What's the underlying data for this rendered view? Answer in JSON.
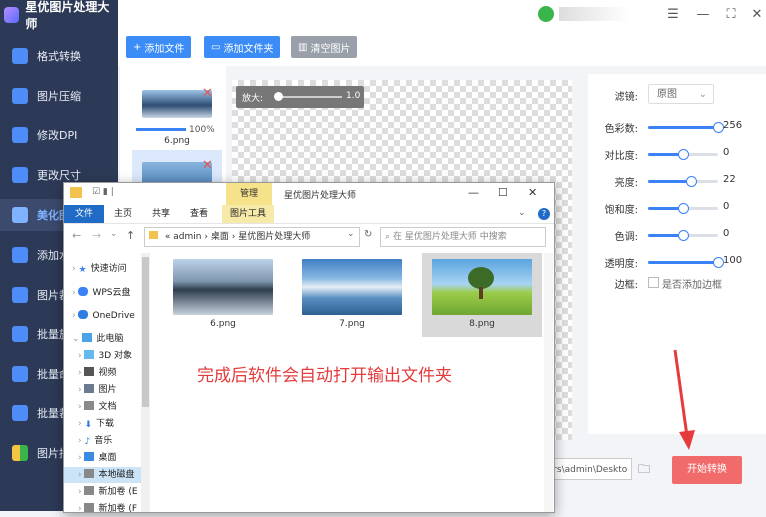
{
  "app": {
    "title": "星优图片处理大师"
  },
  "topbar": {
    "icons": [
      "user-avatar",
      "settings-icon",
      "minimize-icon",
      "maximize-icon",
      "close-icon"
    ]
  },
  "sidebar": {
    "items": [
      {
        "label": "格式转换",
        "icon": "format-convert-icon"
      },
      {
        "label": "图片压缩",
        "icon": "compress-icon"
      },
      {
        "label": "修改DPI",
        "icon": "dpi-icon"
      },
      {
        "label": "更改尺寸",
        "icon": "resize-icon"
      },
      {
        "label": "美化图片",
        "icon": "beautify-icon",
        "active": true
      },
      {
        "label": "添加水印",
        "icon": "watermark-icon"
      },
      {
        "label": "图片裁剪",
        "icon": "crop-icon"
      },
      {
        "label": "批量旋转",
        "icon": "rotate-icon"
      },
      {
        "label": "批量命名",
        "icon": "rename-icon"
      },
      {
        "label": "批量裁剪",
        "icon": "batch-crop-icon"
      },
      {
        "label": "图片拼接",
        "icon": "stitch-icon"
      }
    ]
  },
  "toolbar": {
    "add_file": "添加文件",
    "add_folder": "添加文件夹",
    "clear": "清空图片"
  },
  "files": [
    {
      "name": "6.png",
      "progress": "100%",
      "progress_value": 1.0
    },
    {
      "name": "",
      "progress": ""
    }
  ],
  "preview": {
    "zoom_label": "放大:",
    "zoom_value": "1.0"
  },
  "settings": {
    "filter_label": "滤镜:",
    "filter_value": "原图",
    "sliders": [
      {
        "label": "色彩数:",
        "value": "256",
        "fraction": 1.0
      },
      {
        "label": "对比度:",
        "value": "0",
        "fraction": 0.5
      },
      {
        "label": "亮度:",
        "value": "22",
        "fraction": 0.61
      },
      {
        "label": "饱和度:",
        "value": "0",
        "fraction": 0.5
      },
      {
        "label": "色调:",
        "value": "0",
        "fraction": 0.5
      },
      {
        "label": "透明度:",
        "value": "100",
        "fraction": 1.0
      }
    ],
    "border_label": "边框:",
    "border_checkbox": "是否添加边框"
  },
  "bottom": {
    "output_path": "sers\\admin\\Deskto",
    "start_button": "开始转换"
  },
  "explorer": {
    "context_tab": "管理",
    "title": "星优图片处理大师",
    "ribbon_tabs": [
      "文件",
      "主页",
      "共享",
      "查看",
      "图片工具"
    ],
    "address": [
      "«",
      "admin",
      "›",
      "桌面",
      "›",
      "星优图片处理大师"
    ],
    "search_placeholder": "在 星优图片处理大师 中搜索",
    "nav": [
      {
        "label": "快速访问",
        "icon": "star-icon"
      },
      {
        "label": "WPS云盘",
        "icon": "cloud-icon"
      },
      {
        "label": "OneDrive",
        "icon": "onedrive-icon"
      },
      {
        "label": "此电脑",
        "icon": "computer-icon"
      },
      {
        "label": "3D 对象",
        "icon": "cube-icon"
      },
      {
        "label": "视频",
        "icon": "video-icon"
      },
      {
        "label": "图片",
        "icon": "picture-icon"
      },
      {
        "label": "文档",
        "icon": "document-icon"
      },
      {
        "label": "下载",
        "icon": "download-icon"
      },
      {
        "label": "音乐",
        "icon": "music-icon"
      },
      {
        "label": "桌面",
        "icon": "desktop-icon"
      },
      {
        "label": "本地磁盘",
        "icon": "disk-icon"
      },
      {
        "label": "新加卷 (E",
        "icon": "disk-icon"
      },
      {
        "label": "新加卷 (F",
        "icon": "disk-icon"
      }
    ],
    "files": [
      {
        "name": "6.png"
      },
      {
        "name": "7.png"
      },
      {
        "name": "8.png"
      }
    ],
    "annotation": "完成后软件会自动打开输出文件夹"
  }
}
